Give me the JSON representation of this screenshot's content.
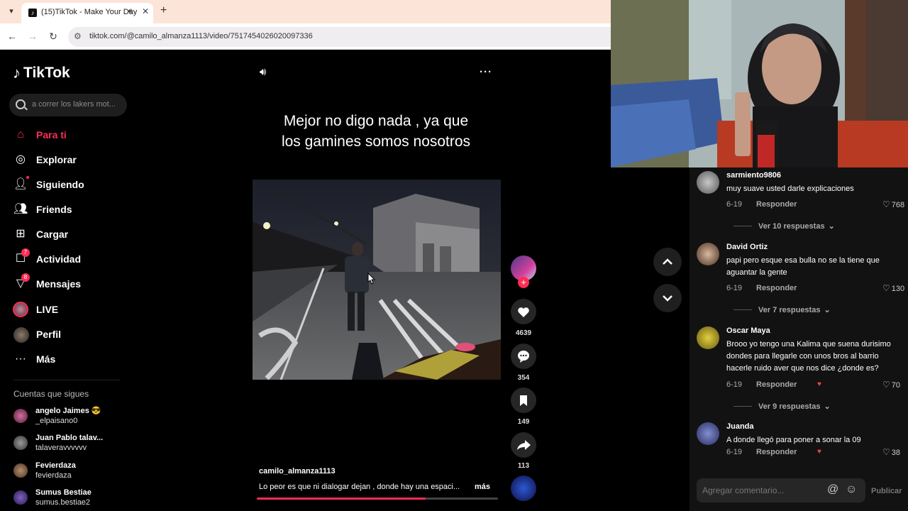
{
  "browser": {
    "tab_title": "(15)TikTok - Make Your Day",
    "url": "tiktok.com/@camilo_almanza1113/video/7517454026020097336"
  },
  "sidebar": {
    "logo_text": "TikTok",
    "search_placeholder": "a correr los lakers mot...",
    "nav": [
      {
        "label": "Para ti",
        "icon": "home-icon",
        "active": true
      },
      {
        "label": "Explorar",
        "icon": "compass-icon"
      },
      {
        "label": "Siguiendo",
        "icon": "following-icon"
      },
      {
        "label": "Friends",
        "icon": "friends-icon"
      },
      {
        "label": "Cargar",
        "icon": "upload-icon"
      },
      {
        "label": "Actividad",
        "icon": "activity-icon",
        "badge": "7"
      },
      {
        "label": "Mensajes",
        "icon": "messages-icon",
        "badge": "8"
      },
      {
        "label": "LIVE",
        "icon": "live-icon"
      },
      {
        "label": "Perfil",
        "icon": "profile-icon"
      },
      {
        "label": "Más",
        "icon": "more-icon"
      }
    ],
    "following_title": "Cuentas que sigues",
    "following": [
      {
        "name": "angelo Jaimes 😎",
        "handle": "_elpaisano0"
      },
      {
        "name": "Juan Pablo talav...",
        "handle": "talaveravvvvvv"
      },
      {
        "name": "Fevierdaza",
        "handle": "fevierdaza"
      },
      {
        "name": "Sumus Bestiae",
        "handle": "sumus.bestiae2"
      }
    ]
  },
  "video": {
    "caption": "Mejor no digo nada , ya que los gamines somos nosotros",
    "author": "camilo_almanza1113",
    "description": "Lo peor es que ni dialogar dejan , donde hay una espaci...",
    "more_label": "más",
    "progress": 0.7,
    "likes": "4639",
    "comments": "354",
    "saves": "149",
    "shares": "113"
  },
  "comments": [
    {
      "user": "sarmiento9806",
      "text": "muy suave usted darle explicaciones",
      "date": "6-19",
      "reply_label": "Responder",
      "likes": "768",
      "view_replies": "Ver 10 respuestas"
    },
    {
      "user": "David Ortiz",
      "text": "papi pero esque esa bulla no se la tiene que aguantar la gente",
      "date": "6-19",
      "reply_label": "Responder",
      "likes": "130",
      "view_replies": "Ver 7 respuestas"
    },
    {
      "user": "Oscar Maya",
      "text": "Brooo yo tengo una Kalima que suena durisimo dondes para llegarle con unos bros al barrio hacerle ruido aver que nos dice ¿donde es?",
      "date": "6-19",
      "reply_label": "Responder",
      "likes": "70",
      "view_replies": "Ver 9 respuestas"
    },
    {
      "user": "Juanda",
      "text": "A donde llegó para poner a sonar la 09",
      "date": "6-19",
      "reply_label": "Responder",
      "likes": "38"
    }
  ],
  "comment_input": {
    "placeholder": "Agregar comentario...",
    "publish_label": "Publicar"
  },
  "colors": {
    "accent": "#fe2c55",
    "background": "#000000",
    "panel": "#121212"
  }
}
